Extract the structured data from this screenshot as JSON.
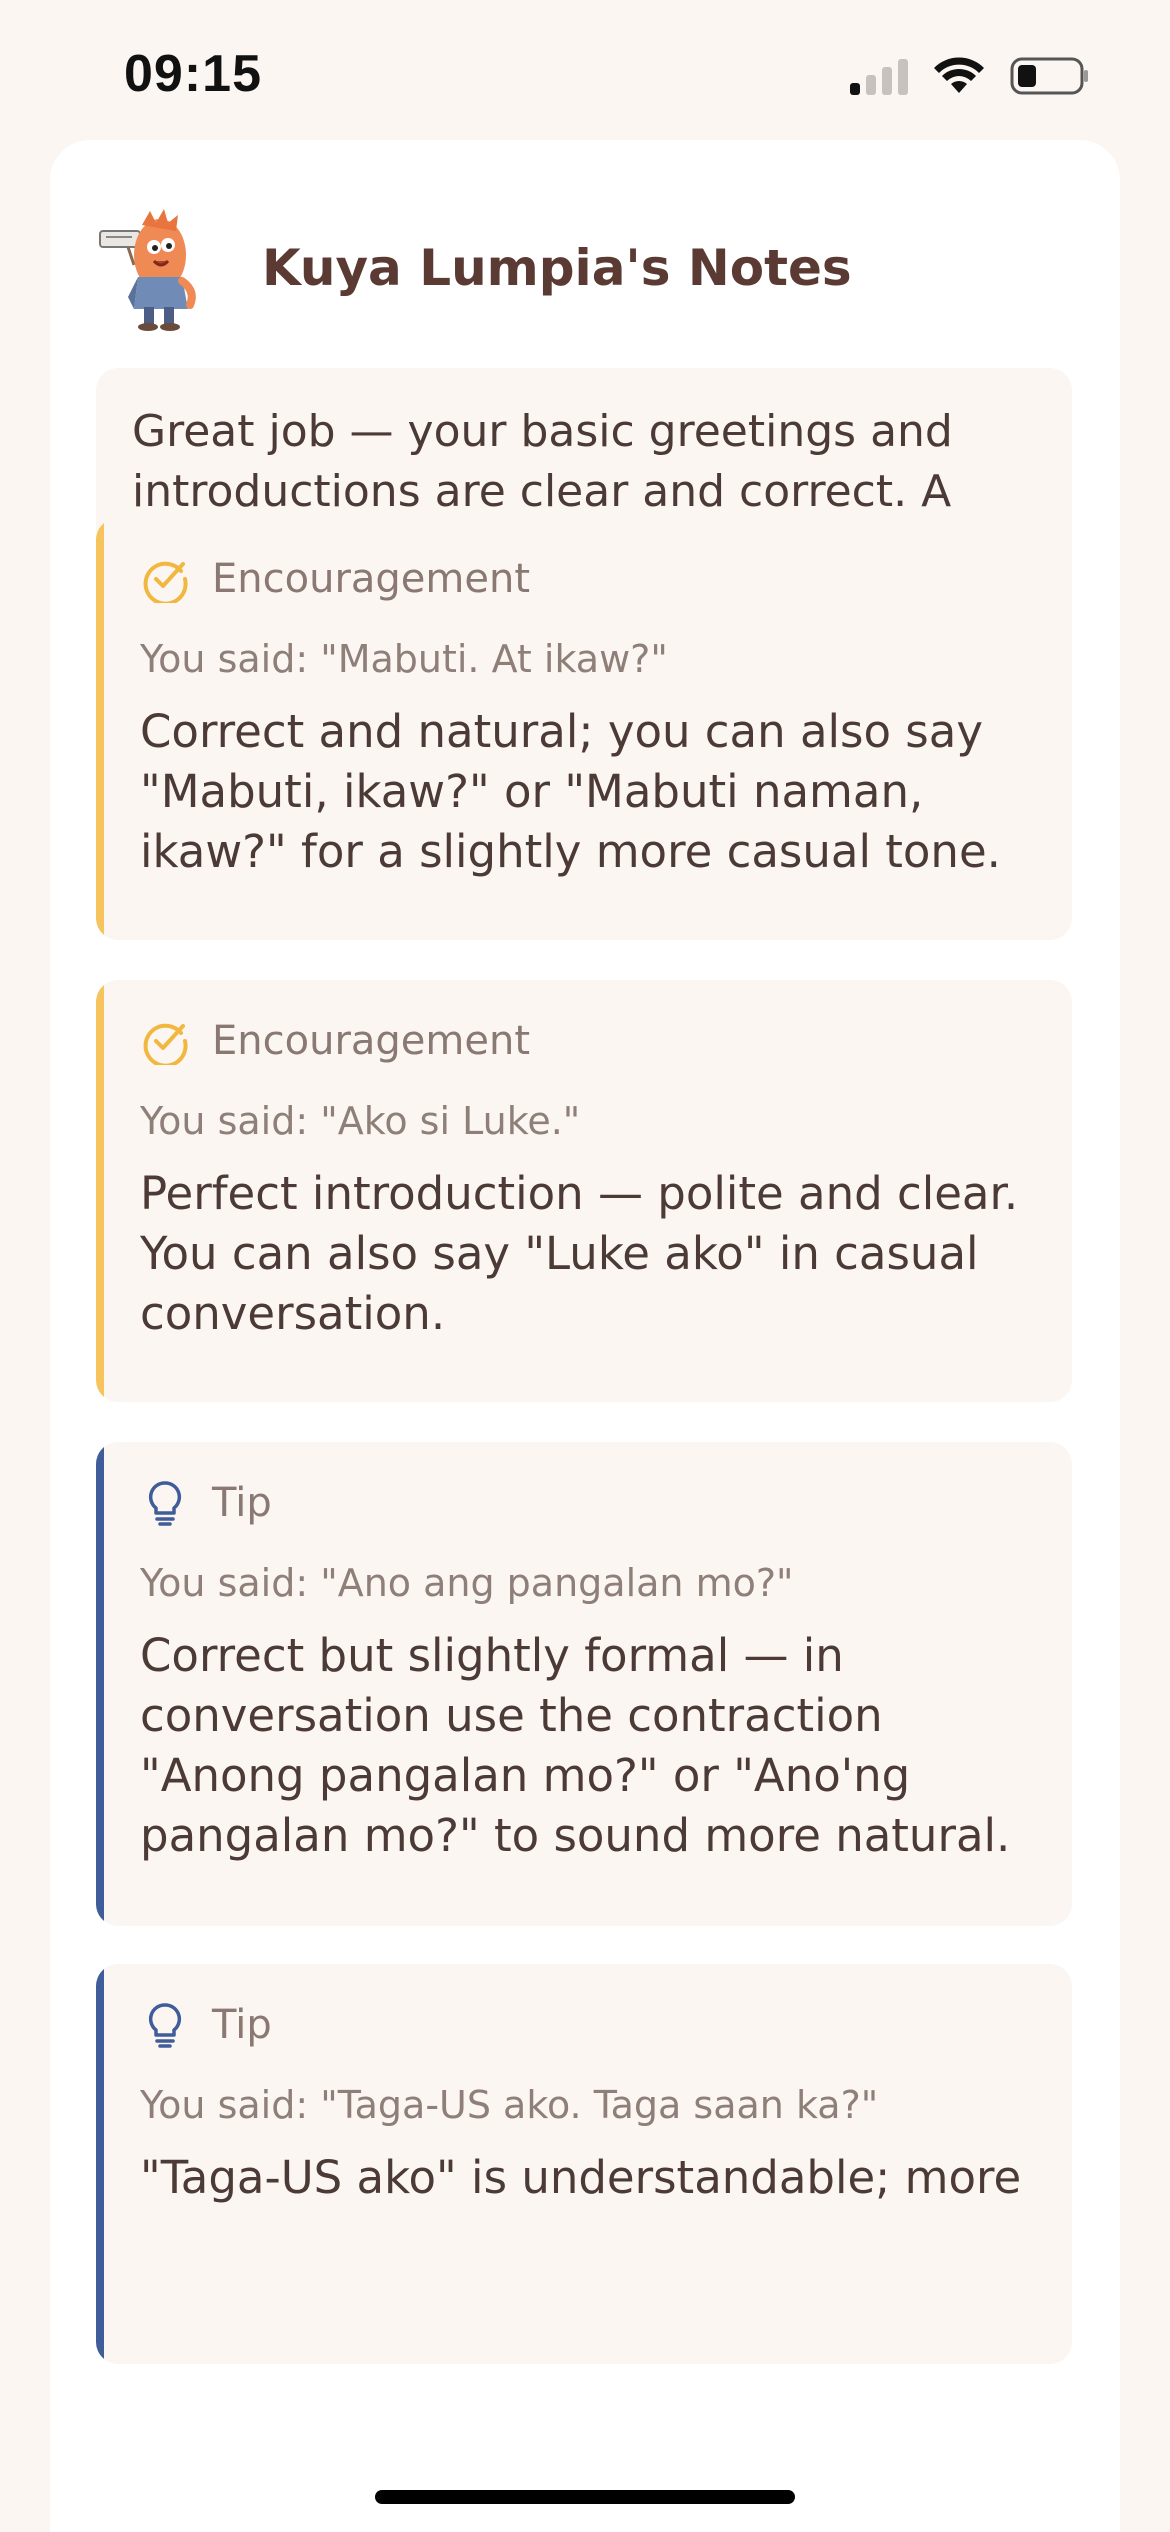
{
  "status_bar": {
    "time": "09:15"
  },
  "header": {
    "title": "Kuya Lumpia's Notes",
    "mascot_icon": "lumpia-mascot"
  },
  "summary": "Great job — your basic greetings and introductions are clear and correct. A few small phrasing tips (contractions and alternative ways to say “from the US”) will make your speech sound more natural.",
  "notes": [
    {
      "type": "Encouragement",
      "icon": "check-circle-icon",
      "said": "You said: \"Mabuti. At ikaw?\"",
      "body": "Correct and natural; you can also say \"Mabuti, ikaw?\" or \"Mabuti naman, ikaw?\" for a slightly more casual tone."
    },
    {
      "type": "Encouragement",
      "icon": "check-circle-icon",
      "said": "You said: \"Ako si Luke.\"",
      "body": "Perfect introduction — polite and clear. You can also say \"Luke ako\" in casual conversation."
    },
    {
      "type": "Tip",
      "icon": "lightbulb-icon",
      "said": "You said: \"Ano ang pangalan mo?\"",
      "body": "Correct but slightly formal — in conversation use the contraction \"Anong pangalan mo?\" or \"Ano'ng pangalan mo?\" to sound more natural."
    },
    {
      "type": "Tip",
      "icon": "lightbulb-icon",
      "said": "You said: \"Taga-US ako. Taga saan ka?\"",
      "body": "\"Taga-US ako\" is understandable; more"
    }
  ],
  "colors": {
    "background": "#fbf6f2",
    "card": "#ffffff",
    "encouragement_accent": "#f6c35c",
    "tip_accent": "#3f5d9a",
    "title": "#5a3a33"
  }
}
